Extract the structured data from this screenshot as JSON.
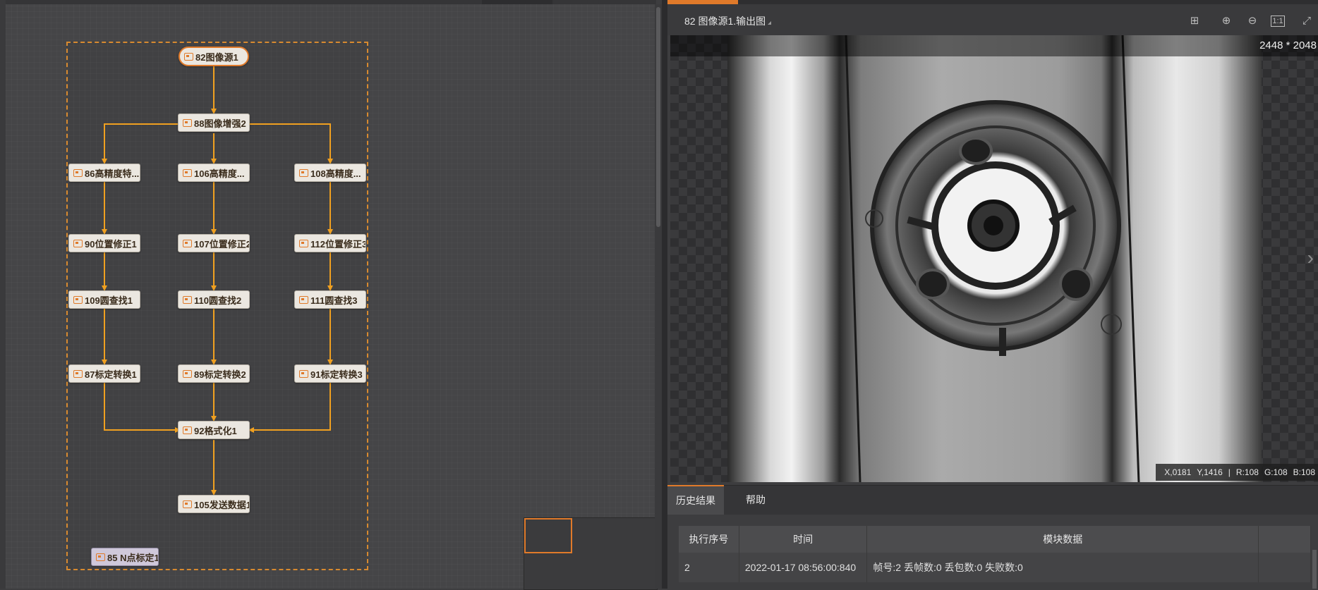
{
  "flow": {
    "nodes": {
      "source": "82图像源1",
      "enhance": "88图像增强2",
      "feat1": "86高精度特...",
      "feat2": "106高精度...",
      "feat3": "108高精度...",
      "pos1": "90位置修正1",
      "pos2": "107位置修正2",
      "pos3": "112位置修正3",
      "circle1": "109圆查找1",
      "circle2": "110圆查找2",
      "circle3": "111圆查找3",
      "calib1": "87标定转换1",
      "calib2": "89标定转换2",
      "calib3": "91标定转换3",
      "format": "92格式化1",
      "send": "105发送数据1",
      "npoint": "85 N点标定1"
    },
    "accent": "#e07a2a"
  },
  "viewer": {
    "title": "82 图像源1.输出图",
    "toolbar": [
      "grid-toggle-icon",
      "zoom-in-icon",
      "zoom-out-icon",
      "actual-size-icon",
      "fit-window-icon"
    ],
    "image_size": "2448 * 2048",
    "pixel": {
      "x": "X,0181",
      "y": "Y,1416",
      "sep": "|",
      "r": "R:108",
      "g": "G:108",
      "b": "B:108"
    }
  },
  "bottom": {
    "tabs": [
      "历史结果",
      "帮助"
    ],
    "columns": [
      "执行序号",
      "时间",
      "模块数据",
      ""
    ],
    "rows": [
      {
        "seq": "2",
        "time": "2022-01-17 08:56:00:840",
        "data": "帧号:2 丢帧数:0 丢包数:0 失败数:0",
        "extra": ""
      }
    ]
  }
}
